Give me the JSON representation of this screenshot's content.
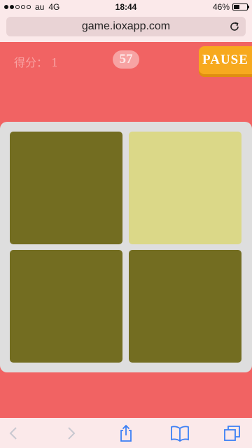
{
  "status": {
    "carrier": "au",
    "network": "4G",
    "time": "18:44",
    "battery": "46%",
    "battery_level": 0.46
  },
  "browser": {
    "url": "game.ioxapp.com"
  },
  "game": {
    "score_label": "得分：",
    "score": "1",
    "timer": "57",
    "pause_label": "PAUSE",
    "grid_size": 2,
    "tile_colors": {
      "base": "#736d21",
      "odd": "#dbd888"
    },
    "tiles": [
      {
        "color": "#736d21"
      },
      {
        "color": "#dbd888"
      },
      {
        "color": "#736d21"
      },
      {
        "color": "#736d21"
      }
    ]
  },
  "colors": {
    "background": "#f16363",
    "board": "#dedede",
    "pause": "#f7a91e",
    "toolbar_icon": "#3b7ff5"
  },
  "toolbar": {
    "icons": [
      "back-icon",
      "forward-icon",
      "share-icon",
      "bookmarks-icon",
      "tabs-icon"
    ]
  }
}
